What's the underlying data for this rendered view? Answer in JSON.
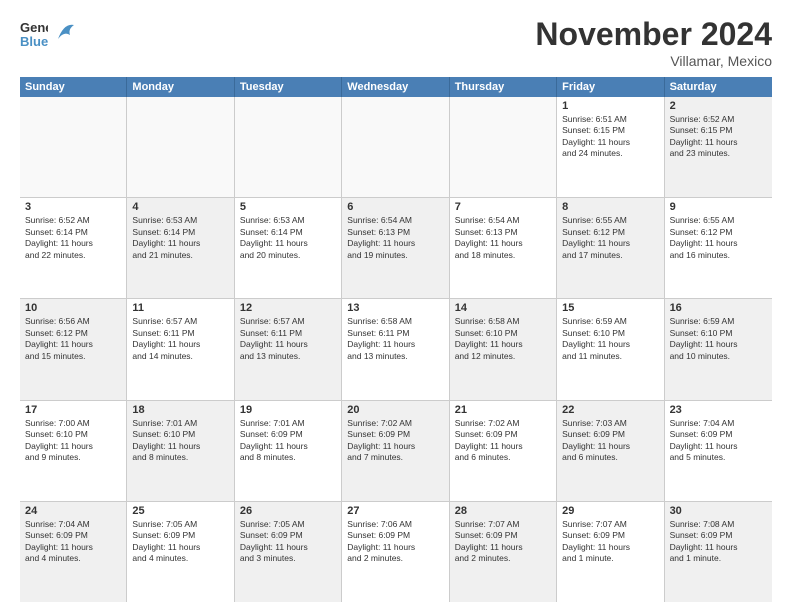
{
  "logo": {
    "line1": "General",
    "line2": "Blue"
  },
  "title": "November 2024",
  "subtitle": "Villamar, Mexico",
  "header_days": [
    "Sunday",
    "Monday",
    "Tuesday",
    "Wednesday",
    "Thursday",
    "Friday",
    "Saturday"
  ],
  "weeks": [
    [
      {
        "day": "",
        "info": "",
        "empty": true
      },
      {
        "day": "",
        "info": "",
        "empty": true
      },
      {
        "day": "",
        "info": "",
        "empty": true
      },
      {
        "day": "",
        "info": "",
        "empty": true
      },
      {
        "day": "",
        "info": "",
        "empty": true
      },
      {
        "day": "1",
        "info": "Sunrise: 6:51 AM\nSunset: 6:15 PM\nDaylight: 11 hours\nand 24 minutes."
      },
      {
        "day": "2",
        "info": "Sunrise: 6:52 AM\nSunset: 6:15 PM\nDaylight: 11 hours\nand 23 minutes.",
        "shaded": true
      }
    ],
    [
      {
        "day": "3",
        "info": "Sunrise: 6:52 AM\nSunset: 6:14 PM\nDaylight: 11 hours\nand 22 minutes."
      },
      {
        "day": "4",
        "info": "Sunrise: 6:53 AM\nSunset: 6:14 PM\nDaylight: 11 hours\nand 21 minutes.",
        "shaded": true
      },
      {
        "day": "5",
        "info": "Sunrise: 6:53 AM\nSunset: 6:14 PM\nDaylight: 11 hours\nand 20 minutes."
      },
      {
        "day": "6",
        "info": "Sunrise: 6:54 AM\nSunset: 6:13 PM\nDaylight: 11 hours\nand 19 minutes.",
        "shaded": true
      },
      {
        "day": "7",
        "info": "Sunrise: 6:54 AM\nSunset: 6:13 PM\nDaylight: 11 hours\nand 18 minutes."
      },
      {
        "day": "8",
        "info": "Sunrise: 6:55 AM\nSunset: 6:12 PM\nDaylight: 11 hours\nand 17 minutes.",
        "shaded": true
      },
      {
        "day": "9",
        "info": "Sunrise: 6:55 AM\nSunset: 6:12 PM\nDaylight: 11 hours\nand 16 minutes."
      }
    ],
    [
      {
        "day": "10",
        "info": "Sunrise: 6:56 AM\nSunset: 6:12 PM\nDaylight: 11 hours\nand 15 minutes.",
        "shaded": true
      },
      {
        "day": "11",
        "info": "Sunrise: 6:57 AM\nSunset: 6:11 PM\nDaylight: 11 hours\nand 14 minutes."
      },
      {
        "day": "12",
        "info": "Sunrise: 6:57 AM\nSunset: 6:11 PM\nDaylight: 11 hours\nand 13 minutes.",
        "shaded": true
      },
      {
        "day": "13",
        "info": "Sunrise: 6:58 AM\nSunset: 6:11 PM\nDaylight: 11 hours\nand 13 minutes."
      },
      {
        "day": "14",
        "info": "Sunrise: 6:58 AM\nSunset: 6:10 PM\nDaylight: 11 hours\nand 12 minutes.",
        "shaded": true
      },
      {
        "day": "15",
        "info": "Sunrise: 6:59 AM\nSunset: 6:10 PM\nDaylight: 11 hours\nand 11 minutes."
      },
      {
        "day": "16",
        "info": "Sunrise: 6:59 AM\nSunset: 6:10 PM\nDaylight: 11 hours\nand 10 minutes.",
        "shaded": true
      }
    ],
    [
      {
        "day": "17",
        "info": "Sunrise: 7:00 AM\nSunset: 6:10 PM\nDaylight: 11 hours\nand 9 minutes."
      },
      {
        "day": "18",
        "info": "Sunrise: 7:01 AM\nSunset: 6:10 PM\nDaylight: 11 hours\nand 8 minutes.",
        "shaded": true
      },
      {
        "day": "19",
        "info": "Sunrise: 7:01 AM\nSunset: 6:09 PM\nDaylight: 11 hours\nand 8 minutes."
      },
      {
        "day": "20",
        "info": "Sunrise: 7:02 AM\nSunset: 6:09 PM\nDaylight: 11 hours\nand 7 minutes.",
        "shaded": true
      },
      {
        "day": "21",
        "info": "Sunrise: 7:02 AM\nSunset: 6:09 PM\nDaylight: 11 hours\nand 6 minutes."
      },
      {
        "day": "22",
        "info": "Sunrise: 7:03 AM\nSunset: 6:09 PM\nDaylight: 11 hours\nand 6 minutes.",
        "shaded": true
      },
      {
        "day": "23",
        "info": "Sunrise: 7:04 AM\nSunset: 6:09 PM\nDaylight: 11 hours\nand 5 minutes."
      }
    ],
    [
      {
        "day": "24",
        "info": "Sunrise: 7:04 AM\nSunset: 6:09 PM\nDaylight: 11 hours\nand 4 minutes.",
        "shaded": true
      },
      {
        "day": "25",
        "info": "Sunrise: 7:05 AM\nSunset: 6:09 PM\nDaylight: 11 hours\nand 4 minutes."
      },
      {
        "day": "26",
        "info": "Sunrise: 7:05 AM\nSunset: 6:09 PM\nDaylight: 11 hours\nand 3 minutes.",
        "shaded": true
      },
      {
        "day": "27",
        "info": "Sunrise: 7:06 AM\nSunset: 6:09 PM\nDaylight: 11 hours\nand 2 minutes."
      },
      {
        "day": "28",
        "info": "Sunrise: 7:07 AM\nSunset: 6:09 PM\nDaylight: 11 hours\nand 2 minutes.",
        "shaded": true
      },
      {
        "day": "29",
        "info": "Sunrise: 7:07 AM\nSunset: 6:09 PM\nDaylight: 11 hours\nand 1 minute."
      },
      {
        "day": "30",
        "info": "Sunrise: 7:08 AM\nSunset: 6:09 PM\nDaylight: 11 hours\nand 1 minute.",
        "shaded": true
      }
    ]
  ]
}
